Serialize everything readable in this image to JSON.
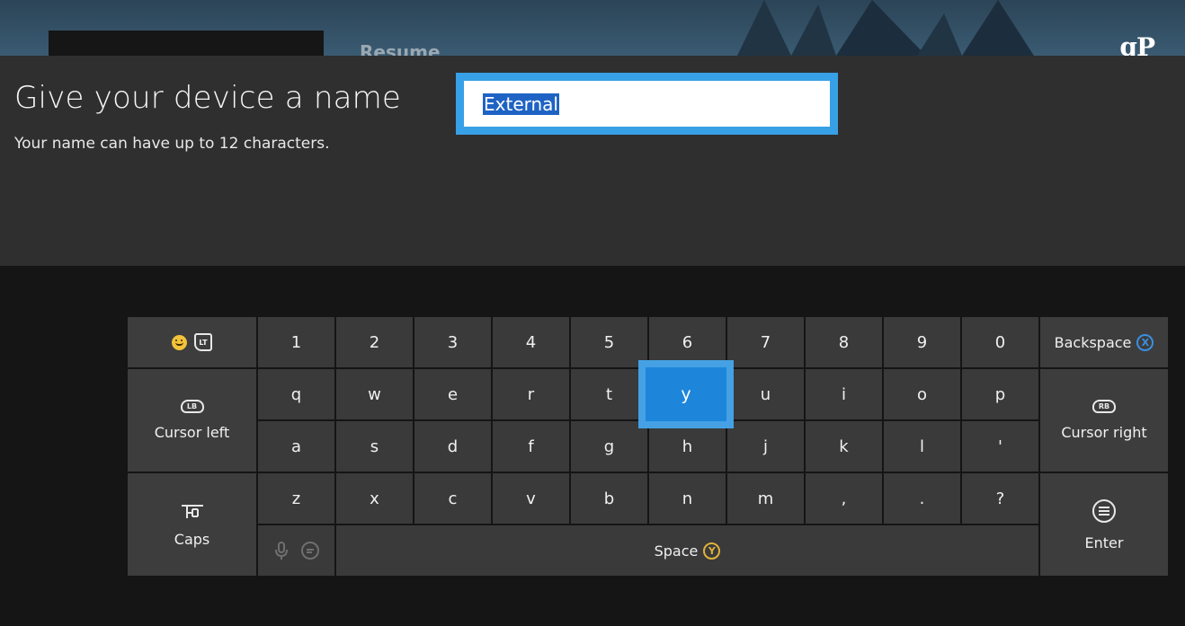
{
  "background": {
    "partial_title": "Resume"
  },
  "brand": {
    "logo": "gP"
  },
  "dialog": {
    "title": "Give your device a name",
    "subtitle": "Your name can have up to 12 characters.",
    "input_value": "External"
  },
  "keyboard": {
    "row1": [
      "1",
      "2",
      "3",
      "4",
      "5",
      "6",
      "7",
      "8",
      "9",
      "0"
    ],
    "row2": [
      "q",
      "w",
      "e",
      "r",
      "t",
      "y",
      "u",
      "i",
      "o",
      "p"
    ],
    "row3": [
      "a",
      "s",
      "d",
      "f",
      "g",
      "h",
      "j",
      "k",
      "l",
      "'"
    ],
    "row4": [
      "z",
      "x",
      "c",
      "v",
      "b",
      "n",
      "m",
      ",",
      ".",
      "?"
    ],
    "focused_key": "y",
    "lt_badge": "LT",
    "backspace_label": "Backspace",
    "backspace_button": "X",
    "cursor_left_label": "Cursor left",
    "lb_badge": "LB",
    "cursor_right_label": "Cursor right",
    "rb_badge": "RB",
    "caps_label": "Caps",
    "space_label": "Space",
    "space_button": "Y",
    "enter_label": "Enter"
  },
  "colors": {
    "accent": "#37a0e6",
    "focus": "#1d86db",
    "panel": "#2f2f2f",
    "key": "#3a3a3a",
    "x_button": "#3b8fe0",
    "y_button": "#e0b23a"
  }
}
